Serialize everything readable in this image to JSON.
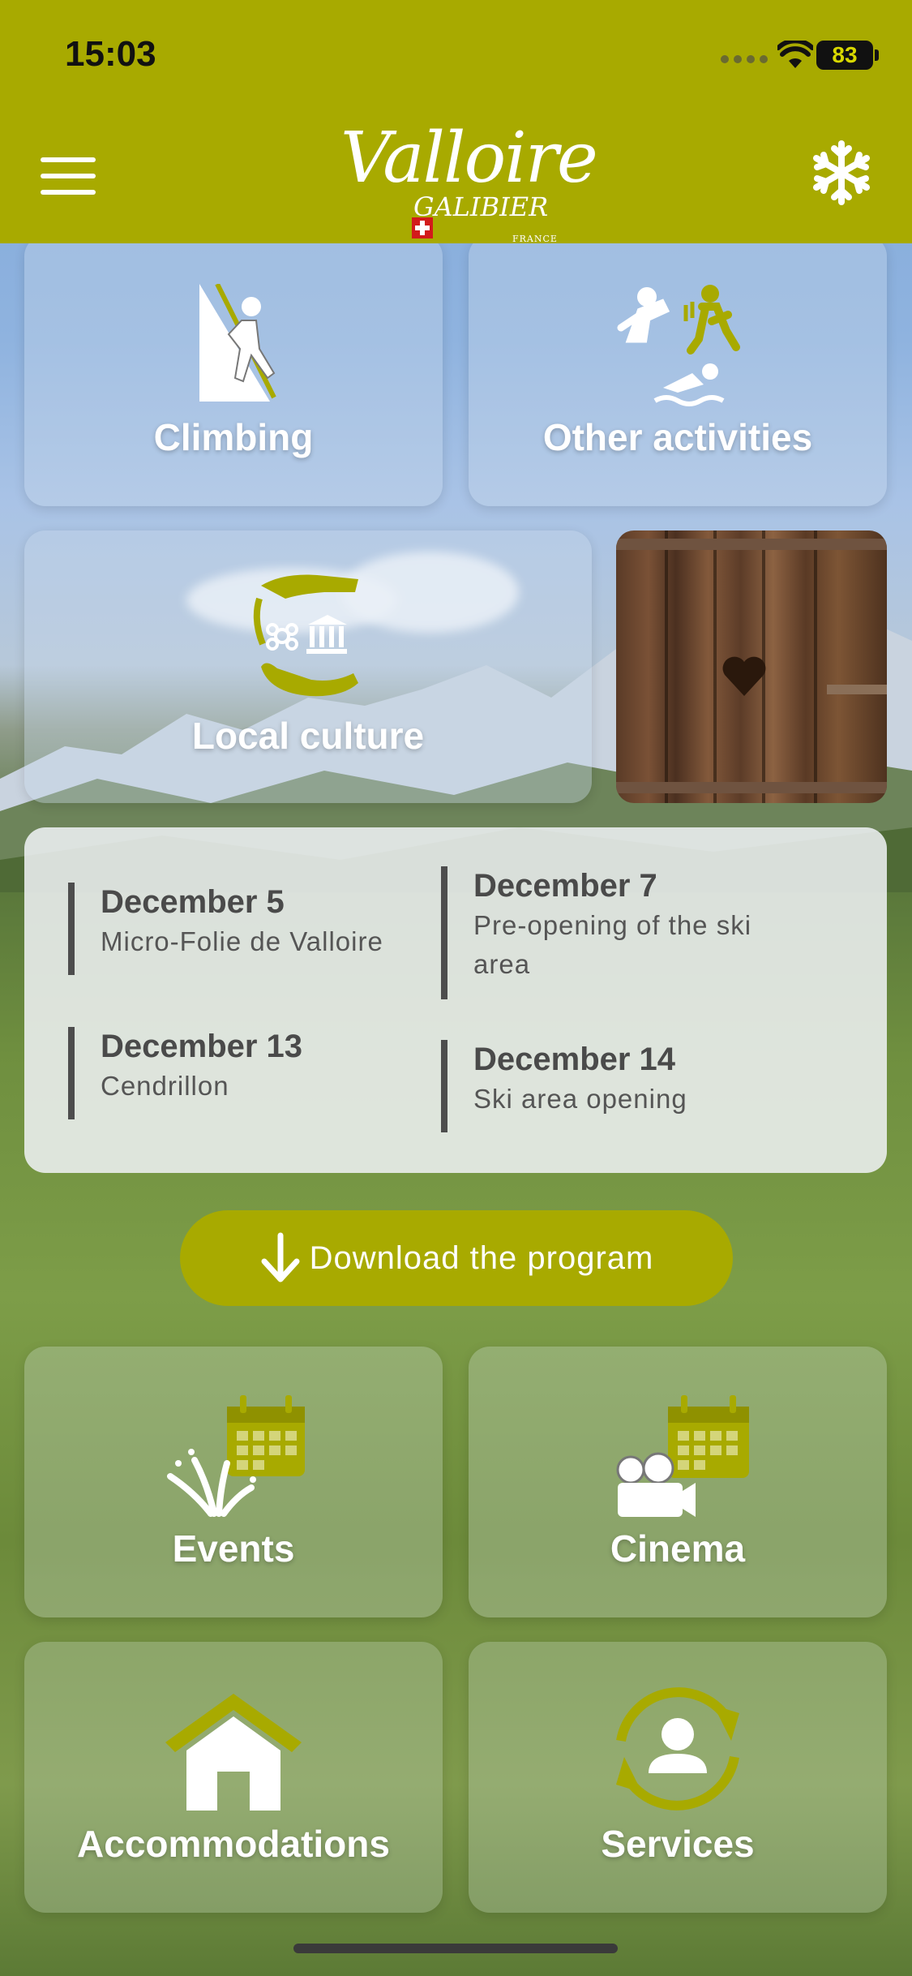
{
  "status_bar": {
    "time": "15:03",
    "battery": "83",
    "icons": [
      "signal-dots-icon",
      "wifi-icon",
      "battery-icon"
    ]
  },
  "header": {
    "logo_main": "Valloire",
    "logo_sub": "GALIBIER",
    "logo_country": "FRANCE",
    "menu_icon": "hamburger-menu-icon",
    "season_icon": "snowflake-icon",
    "brand_color": "#a8aa00"
  },
  "tiles": {
    "climbing": {
      "label": "Climbing",
      "icon": "climber-icon"
    },
    "other_activities": {
      "label": "Other activities",
      "icon": "sports-activities-icon"
    },
    "local_culture": {
      "label": "Local culture",
      "icon": "culture-hands-icon"
    },
    "events": {
      "label": "Events",
      "icon": "fireworks-calendar-icon"
    },
    "cinema": {
      "label": "Cinema",
      "icon": "camera-calendar-icon"
    },
    "accommodations": {
      "label": "Accommodations",
      "icon": "house-icon"
    },
    "services": {
      "label": "Services",
      "icon": "person-refresh-icon"
    }
  },
  "upcoming_events": [
    {
      "date": "December 5",
      "title": "Micro-Folie de Valloire"
    },
    {
      "date": "December 7",
      "title_line1": "Pre-opening of the ski",
      "title_line2": "area"
    },
    {
      "date": "December 13",
      "title": "Cendrillon"
    },
    {
      "date": "December 14",
      "title": "Ski area opening"
    }
  ],
  "download_button": {
    "label": "Download the program",
    "icon": "arrow-down-icon"
  }
}
